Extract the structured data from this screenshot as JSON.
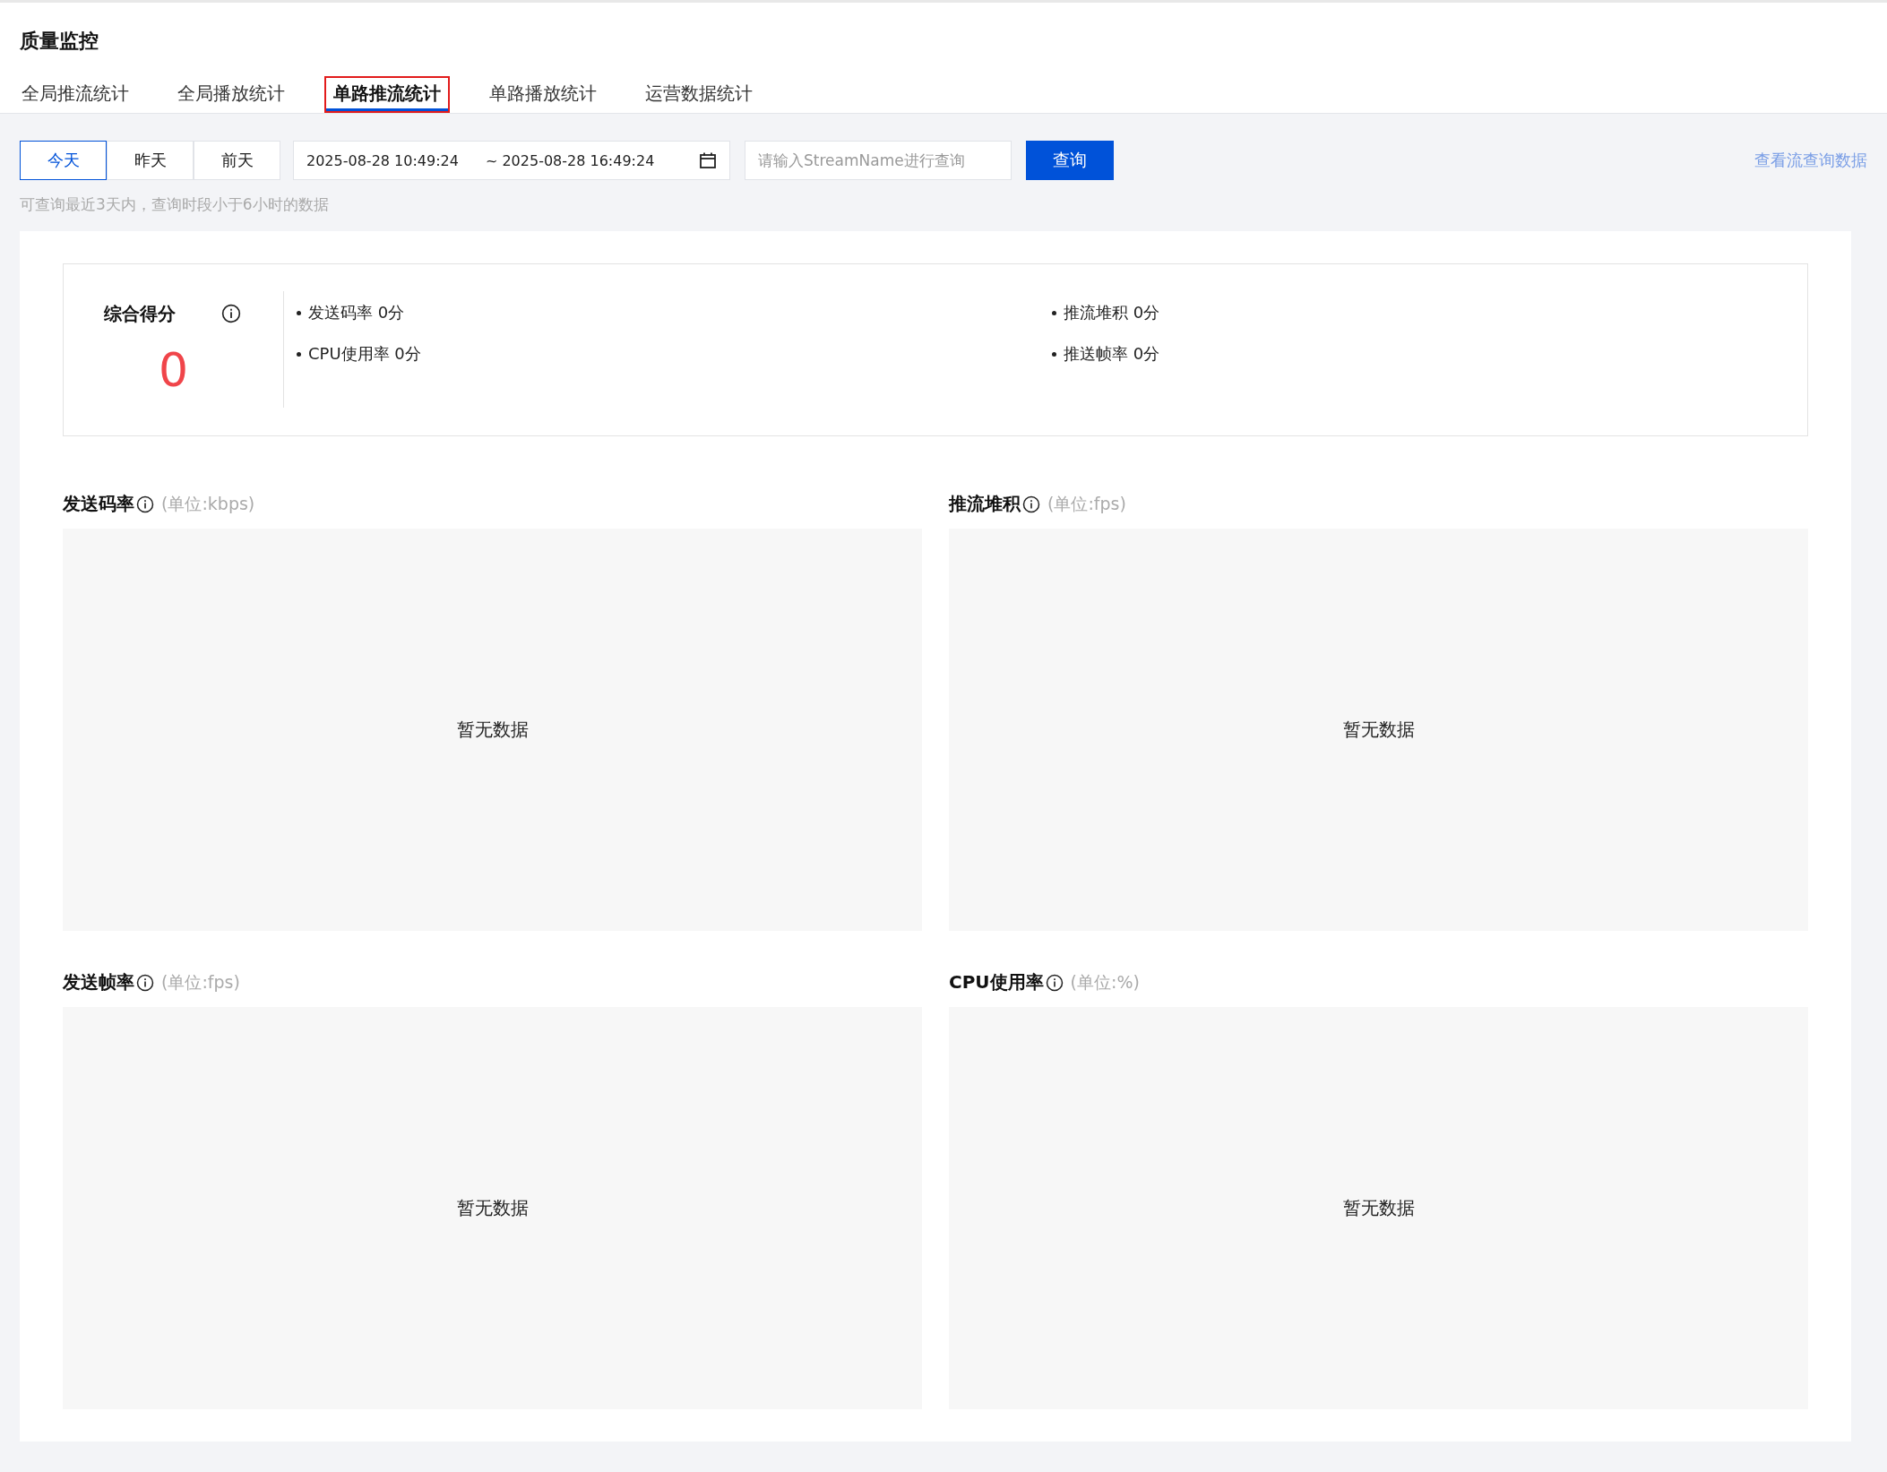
{
  "page_title": "质量监控",
  "tabs": [
    {
      "label": "全局推流统计",
      "selected": false
    },
    {
      "label": "全局播放统计",
      "selected": false
    },
    {
      "label": "单路推流统计",
      "selected": true
    },
    {
      "label": "单路播放统计",
      "selected": false
    },
    {
      "label": "运营数据统计",
      "selected": false
    }
  ],
  "day_buttons": [
    {
      "label": "今天",
      "selected": true
    },
    {
      "label": "昨天",
      "selected": false
    },
    {
      "label": "前天",
      "selected": false
    }
  ],
  "date_range": {
    "start": "2025-08-28 10:49:24",
    "end": "~ 2025-08-28 16:49:24"
  },
  "stream_search": {
    "placeholder": "请输入StreamName进行查询"
  },
  "query_button": "查询",
  "view_link": "查看流查询数据",
  "hint": "可查询最近3天内，查询时段小于6小时的数据",
  "score": {
    "title": "综合得分",
    "value": "0",
    "items": [
      {
        "text": "发送码率 0分"
      },
      {
        "text": "推流堆积 0分"
      },
      {
        "text": "CPU使用率 0分"
      },
      {
        "text": "推送帧率 0分"
      }
    ]
  },
  "charts": [
    {
      "title": "发送码率",
      "unit": "(单位:kbps)",
      "empty_text": "暂无数据"
    },
    {
      "title": "推流堆积",
      "unit": "(单位:fps)",
      "empty_text": "暂无数据"
    },
    {
      "title": "发送帧率",
      "unit": "(单位:fps)",
      "empty_text": "暂无数据"
    },
    {
      "title": "CPU使用率",
      "unit": "(单位:%)",
      "empty_text": "暂无数据"
    }
  ]
}
